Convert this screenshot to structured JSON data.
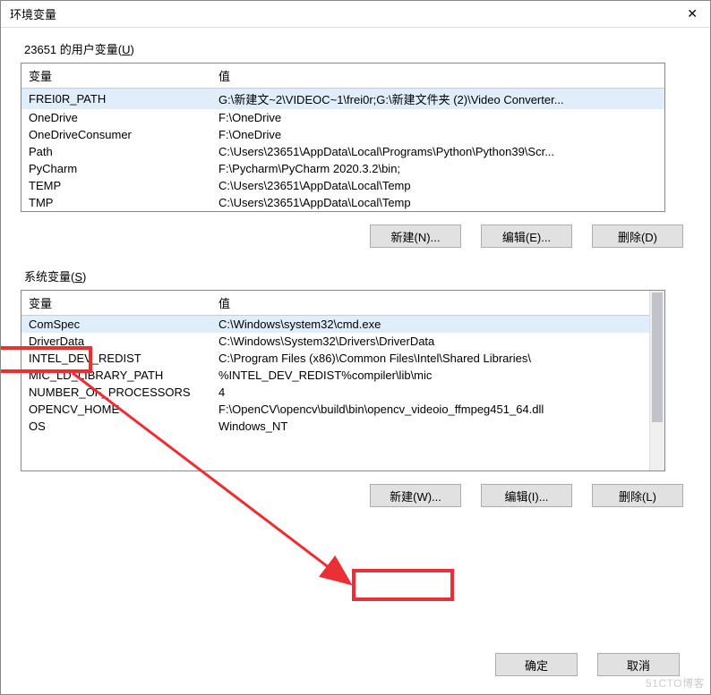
{
  "window": {
    "title": "环境变量"
  },
  "user_section": {
    "label_prefix": "23651 的用户变量(",
    "label_hotkey": "U",
    "label_suffix": ")",
    "col_var": "变量",
    "col_val": "值",
    "rows": [
      {
        "name": "FREI0R_PATH",
        "value": "G:\\新建文~2\\VIDEOC~1\\frei0r;G:\\新建文件夹 (2)\\Video Converter..."
      },
      {
        "name": "OneDrive",
        "value": "F:\\OneDrive"
      },
      {
        "name": "OneDriveConsumer",
        "value": "F:\\OneDrive"
      },
      {
        "name": "Path",
        "value": "C:\\Users\\23651\\AppData\\Local\\Programs\\Python\\Python39\\Scr..."
      },
      {
        "name": "PyCharm",
        "value": "F:\\Pycharm\\PyCharm 2020.3.2\\bin;"
      },
      {
        "name": "TEMP",
        "value": "C:\\Users\\23651\\AppData\\Local\\Temp"
      },
      {
        "name": "TMP",
        "value": "C:\\Users\\23651\\AppData\\Local\\Temp"
      }
    ],
    "btn_new": "新建(N)...",
    "btn_edit": "编辑(E)...",
    "btn_delete": "删除(D)"
  },
  "sys_section": {
    "label_prefix": "系统变量(",
    "label_hotkey": "S",
    "label_suffix": ")",
    "col_var": "变量",
    "col_val": "值",
    "rows": [
      {
        "name": "ComSpec",
        "value": "C:\\Windows\\system32\\cmd.exe"
      },
      {
        "name": "DriverData",
        "value": "C:\\Windows\\System32\\Drivers\\DriverData"
      },
      {
        "name": "INTEL_DEV_REDIST",
        "value": "C:\\Program Files (x86)\\Common Files\\Intel\\Shared Libraries\\"
      },
      {
        "name": "MIC_LD_LIBRARY_PATH",
        "value": "%INTEL_DEV_REDIST%compiler\\lib\\mic"
      },
      {
        "name": "NUMBER_OF_PROCESSORS",
        "value": "4"
      },
      {
        "name": "OPENCV_HOME",
        "value": "F:\\OpenCV\\opencv\\build\\bin\\opencv_videoio_ffmpeg451_64.dll"
      },
      {
        "name": "OS",
        "value": "Windows_NT"
      }
    ],
    "btn_new": "新建(W)...",
    "btn_edit": "编辑(I)...",
    "btn_delete": "删除(L)"
  },
  "footer": {
    "ok": "确定",
    "cancel": "取消"
  },
  "watermark": "51CTO博客"
}
